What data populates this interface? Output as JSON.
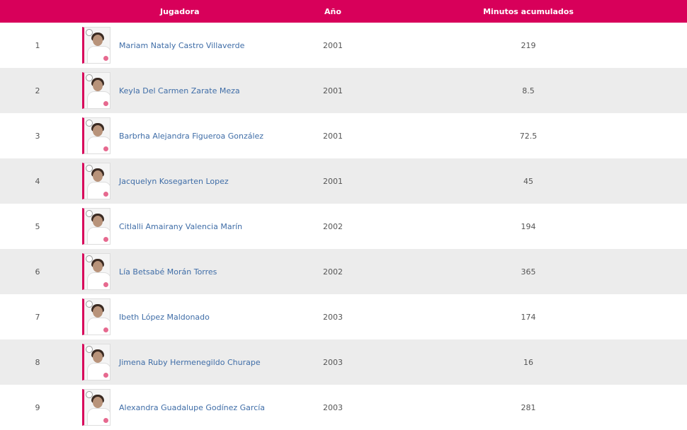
{
  "header": {
    "name": "Jugadora",
    "year": "Año",
    "minutes": "Minutos acumulados"
  },
  "colors": {
    "header_bg": "#d8005a",
    "row_alt_bg": "#ececec",
    "link": "#3f6da7"
  },
  "rows": [
    {
      "index": "1",
      "name": "Mariam Nataly Castro Villaverde",
      "year": "2001",
      "minutes": "219"
    },
    {
      "index": "2",
      "name": "Keyla Del Carmen Zarate Meza",
      "year": "2001",
      "minutes": "8.5"
    },
    {
      "index": "3",
      "name": "Barbrha Alejandra Figueroa González",
      "year": "2001",
      "minutes": "72.5"
    },
    {
      "index": "4",
      "name": "Jacquelyn Kosegarten Lopez",
      "year": "2001",
      "minutes": "45"
    },
    {
      "index": "5",
      "name": "Citlalli Amairany Valencia Marín",
      "year": "2002",
      "minutes": "194"
    },
    {
      "index": "6",
      "name": "Lía Betsabé Morán Torres",
      "year": "2002",
      "minutes": "365"
    },
    {
      "index": "7",
      "name": "Ibeth López Maldonado",
      "year": "2003",
      "minutes": "174"
    },
    {
      "index": "8",
      "name": "Jimena Ruby Hermenegildo Churape",
      "year": "2003",
      "minutes": "16"
    },
    {
      "index": "9",
      "name": "Alexandra Guadalupe Godínez García",
      "year": "2003",
      "minutes": "281"
    }
  ]
}
